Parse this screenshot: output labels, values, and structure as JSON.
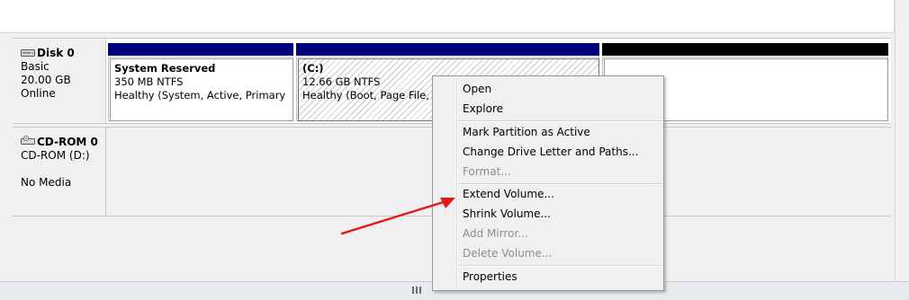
{
  "disks": [
    {
      "name": "Disk 0",
      "type": "Basic",
      "size": "20.00 GB",
      "status": "Online",
      "partitions": [
        {
          "title": "System Reserved",
          "fs": "350 MB NTFS",
          "health": "Healthy (System, Active, Primary Part"
        },
        {
          "title": "(C:)",
          "fs": "12.66 GB NTFS",
          "health": "Healthy (Boot, Page File, Cr"
        },
        {
          "title": "",
          "fs": "",
          "health": ""
        }
      ]
    },
    {
      "name": "CD-ROM 0",
      "type": "CD-ROM (D:)",
      "status": "No Media"
    }
  ],
  "context_menu": {
    "items": [
      {
        "label": "Open",
        "enabled": true
      },
      {
        "label": "Explore",
        "enabled": true
      },
      {
        "label": "Mark Partition as Active",
        "enabled": true
      },
      {
        "label": "Change Drive Letter and Paths...",
        "enabled": true
      },
      {
        "label": "Format...",
        "enabled": false
      },
      {
        "label": "Extend Volume...",
        "enabled": true
      },
      {
        "label": "Shrink Volume...",
        "enabled": true
      },
      {
        "label": "Add Mirror...",
        "enabled": false
      },
      {
        "label": "Delete Volume...",
        "enabled": false
      },
      {
        "label": "Properties",
        "enabled": true
      }
    ]
  },
  "colors": {
    "primary_partition_bar": "#00007b",
    "unallocated_bar": "#000000",
    "annotation_arrow": "#e3191c",
    "disabled_text": "#8d8d8d"
  },
  "icons": {
    "disk": "hard-disk-icon",
    "cdrom": "cd-rom-drive-icon",
    "splitter": "splitter-grip-icon"
  }
}
